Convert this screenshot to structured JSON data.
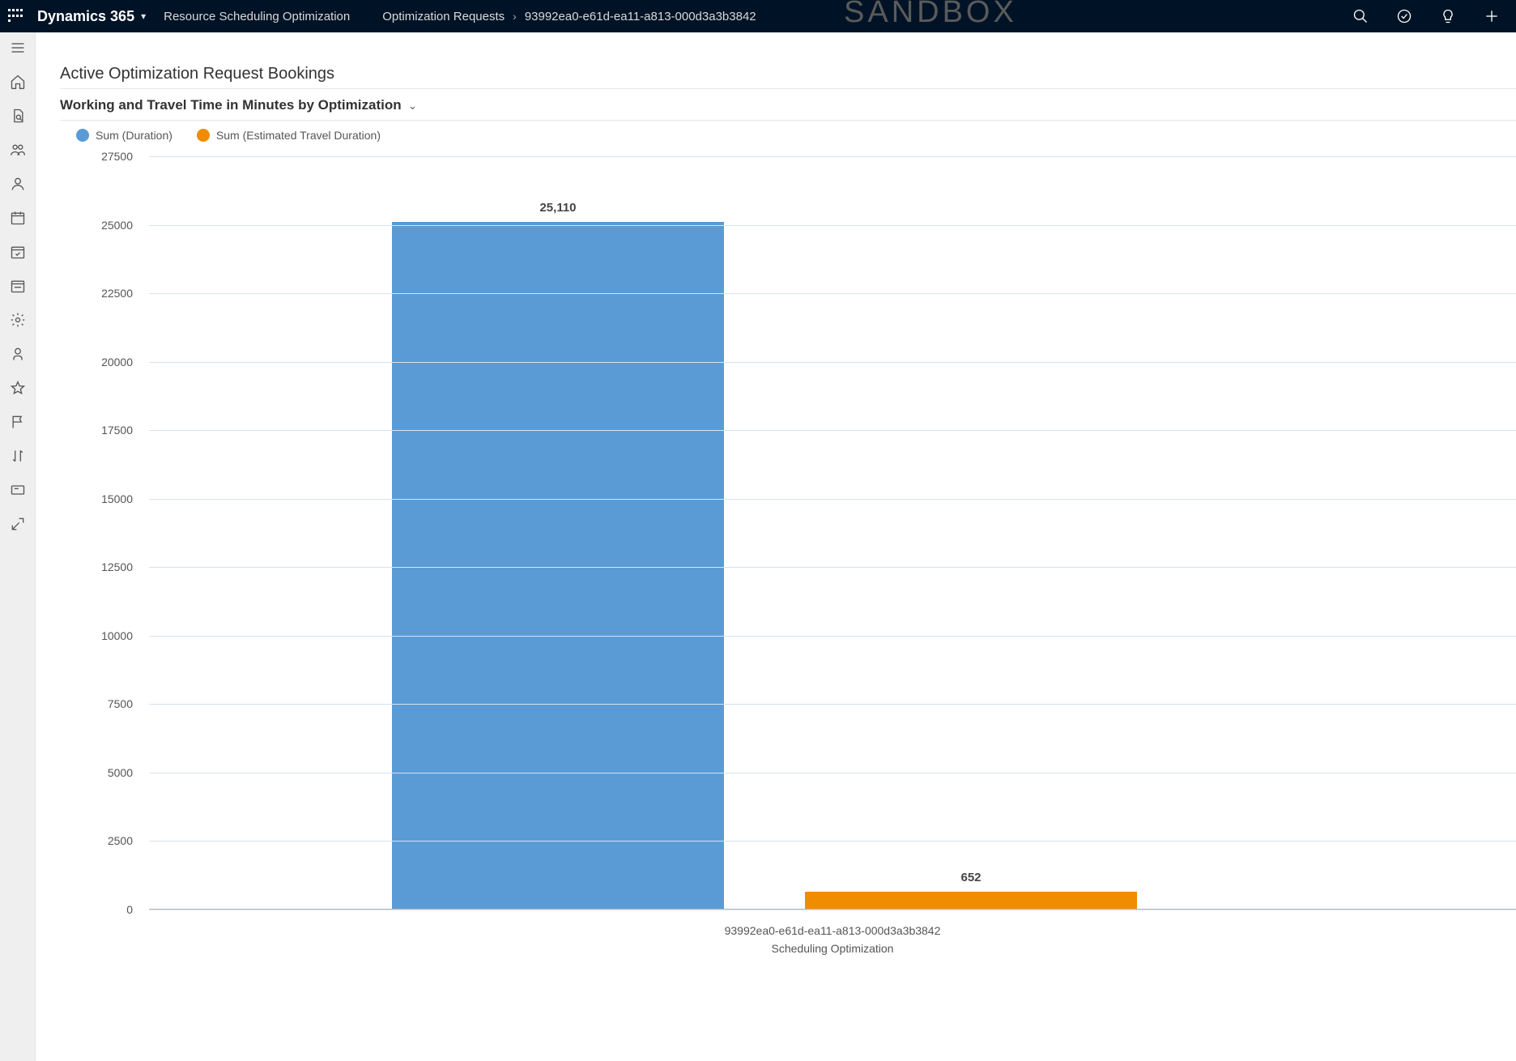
{
  "header": {
    "brand": "Dynamics 365",
    "app": "Resource Scheduling Optimization",
    "breadcrumb1": "Optimization Requests",
    "breadcrumb2": "93992ea0-e61d-ea11-a813-000d3a3b3842",
    "env": "SANDBOX"
  },
  "section_title": "Active Optimization Request Bookings",
  "chart_title": "Working and Travel Time in Minutes by Optimization",
  "legend": {
    "series1": "Sum (Duration)",
    "series2": "Sum (Estimated Travel Duration)"
  },
  "chart_data": {
    "type": "bar",
    "categories": [
      "93992ea0-e61d-ea11-a813-000d3a3b3842"
    ],
    "series": [
      {
        "name": "Sum (Duration)",
        "color": "#5a9bd5",
        "values": [
          25110
        ],
        "labels": [
          "25,110"
        ]
      },
      {
        "name": "Sum (Estimated Travel Duration)",
        "color": "#f08c00",
        "values": [
          652
        ],
        "labels": [
          "652"
        ]
      }
    ],
    "xlabel": "Scheduling Optimization",
    "ylabel": "",
    "ylim": [
      0,
      27500
    ],
    "y_ticks": [
      0,
      2500,
      5000,
      7500,
      10000,
      12500,
      15000,
      17500,
      20000,
      22500,
      25000,
      27500
    ]
  }
}
